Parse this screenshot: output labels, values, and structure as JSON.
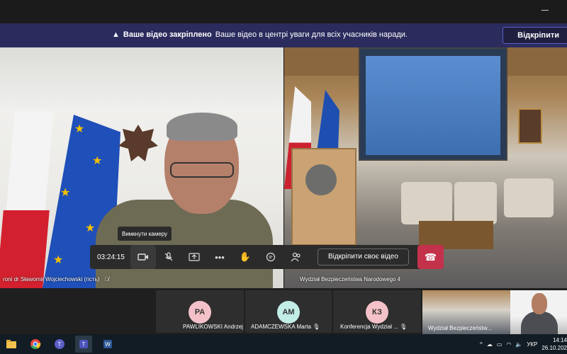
{
  "banner": {
    "bold": "Ваше відео закріплено",
    "text": "Ваше відео в центрі уваги для всіх учасників наради.",
    "unpin_label": "Відкріпити"
  },
  "stage": {
    "left_label": "roni dr Sławomir Wojciechowski (гість)",
    "right_label": "Wydział Bezpieczeństwa Narodowego 4"
  },
  "controls": {
    "timer": "03:24:15",
    "tooltip": "Вимкнути камеру",
    "unpin_video_label": "Відкріпити своє відео"
  },
  "participants": [
    {
      "initials": "PA",
      "name": "PAWLIKOWSKI Andrzej",
      "color": "#f4c1c8"
    },
    {
      "initials": "AM",
      "name": "ADAMCZEWSKA Marta",
      "color": "#c2ece6"
    },
    {
      "initials": "КЗ",
      "name": "Konferencja Wydział ...",
      "color": "#f4c1c8"
    }
  ],
  "thumb_room_label": "Wydział Bezpieczeństw...",
  "taskbar": {
    "language": "УКР",
    "time": "14:14",
    "date": "26.10.202"
  },
  "icons": [
    "warning-icon",
    "camera-icon",
    "mic-off-icon",
    "share-icon",
    "more-icon",
    "raise-hand-icon",
    "chat-icon",
    "people-icon",
    "hangup-icon"
  ]
}
